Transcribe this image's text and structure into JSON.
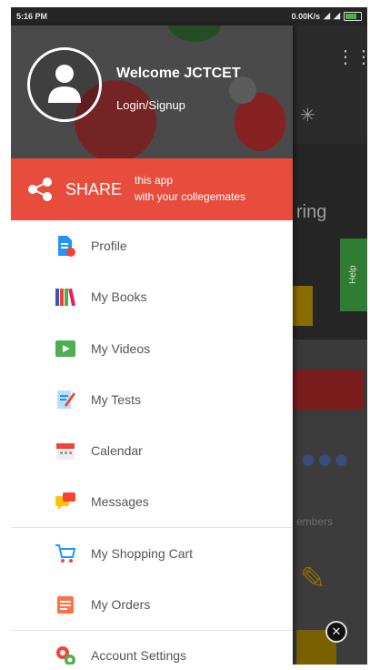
{
  "status_bar": {
    "time": "5:16 PM",
    "network_speed": "0.00K/s"
  },
  "drawer": {
    "welcome_text": "Welcome JCTCET",
    "login_link": "Login/Signup",
    "share": {
      "label": "SHARE",
      "subtitle_line1": "this app",
      "subtitle_line2": "with your collegemates"
    },
    "menu_items": [
      {
        "label": "Profile",
        "icon": "profile-icon"
      },
      {
        "label": "My Books",
        "icon": "books-icon"
      },
      {
        "label": "My Videos",
        "icon": "video-icon"
      },
      {
        "label": "My Tests",
        "icon": "test-icon"
      },
      {
        "label": "Calendar",
        "icon": "calendar-icon"
      },
      {
        "label": "Messages",
        "icon": "messages-icon"
      },
      {
        "label": "My Shopping Cart",
        "icon": "cart-icon"
      },
      {
        "label": "My Orders",
        "icon": "orders-icon"
      },
      {
        "label": "Account Settings",
        "icon": "settings-icon"
      }
    ]
  },
  "background": {
    "banner_text_fragment": "ring",
    "help_label": "Help",
    "members_fragment": "embers"
  },
  "colors": {
    "share_bar": "#e74c3c",
    "header_bg": "#4a4a4a",
    "menu_text": "#555555"
  }
}
